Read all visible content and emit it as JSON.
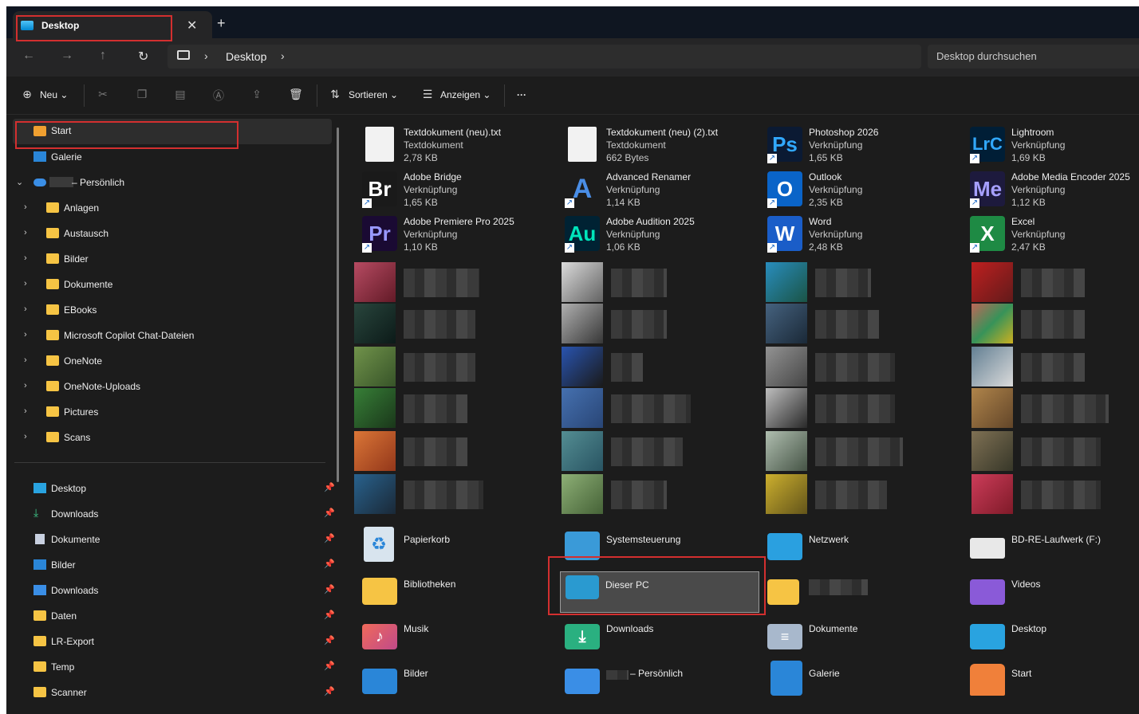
{
  "tab": {
    "title": "Desktop",
    "close": "✕",
    "new": "+"
  },
  "nav": {
    "back": "←",
    "forward": "→",
    "up": "↑",
    "refresh": "↻"
  },
  "address": {
    "segment": "Desktop",
    "sep": "›"
  },
  "search": {
    "placeholder": "Desktop durchsuchen"
  },
  "toolbar": {
    "new": "Neu",
    "sort": "Sortieren",
    "view": "Anzeigen",
    "more": "···"
  },
  "sidebar": {
    "start": "Start",
    "gallery": "Galerie",
    "onedrive": "– Persönlich",
    "folders": [
      "Anlagen",
      "Austausch",
      "Bilder",
      "Dokumente",
      "EBooks",
      "Microsoft Copilot Chat-Dateien",
      "OneNote",
      "OneNote-Uploads",
      "Pictures",
      "Scans"
    ],
    "pinned": [
      "Desktop",
      "Downloads",
      "Dokumente",
      "Bilder",
      "Downloads",
      "Daten",
      "LR-Export",
      "Temp",
      "Scanner"
    ]
  },
  "files": [
    {
      "name": "Textdokument (neu).txt",
      "type": "Textdokument",
      "size": "2,78 KB",
      "icon": "text-file-icon"
    },
    {
      "name": "Textdokument (neu) (2).txt",
      "type": "Textdokument",
      "size": "662 Bytes",
      "icon": "text-file-icon"
    },
    {
      "name": "Photoshop 2026",
      "type": "Verknüpfung",
      "size": "1,65 KB",
      "icon": "Ps"
    },
    {
      "name": "Lightroom",
      "type": "Verknüpfung",
      "size": "1,69 KB",
      "icon": "LrC"
    },
    {
      "name": "Adobe Bridge",
      "type": "Verknüpfung",
      "size": "1,65 KB",
      "icon": "Br"
    },
    {
      "name": "Advanced Renamer",
      "type": "Verknüpfung",
      "size": "1,14 KB",
      "icon": "A"
    },
    {
      "name": "Outlook",
      "type": "Verknüpfung",
      "size": "2,35 KB",
      "icon": "O"
    },
    {
      "name": "Adobe Media Encoder 2025",
      "type": "Verknüpfung",
      "size": "1,12 KB",
      "icon": "Me"
    },
    {
      "name": "Adobe Premiere Pro 2025",
      "type": "Verknüpfung",
      "size": "1,10 KB",
      "icon": "Pr"
    },
    {
      "name": "Adobe Audition 2025",
      "type": "Verknüpfung",
      "size": "1,06 KB",
      "icon": "Au"
    },
    {
      "name": "Word",
      "type": "Verknüpfung",
      "size": "2,48 KB",
      "icon": "W"
    },
    {
      "name": "Excel",
      "type": "Verknüpfung",
      "size": "2,47 KB",
      "icon": "X"
    }
  ],
  "system": [
    {
      "name": "Papierkorb"
    },
    {
      "name": "Systemsteuerung"
    },
    {
      "name": "Netzwerk"
    },
    {
      "name": "BD-RE-Laufwerk (F:)"
    },
    {
      "name": "Bibliotheken"
    },
    {
      "name": "Dieser PC"
    },
    {
      "name": ""
    },
    {
      "name": "Videos"
    },
    {
      "name": "Musik"
    },
    {
      "name": "Downloads"
    },
    {
      "name": "Dokumente"
    },
    {
      "name": "Desktop"
    },
    {
      "name": "Bilder"
    },
    {
      "name": "– Persönlich"
    },
    {
      "name": "Galerie"
    },
    {
      "name": "Start"
    }
  ],
  "colors": {
    "highlight": "#d32f2f",
    "ps": "#0b1a33",
    "lrc": "#001e36",
    "br": "#1a1a1a",
    "me": "#1d1a3d",
    "pr": "#1a0a33",
    "au": "#002233"
  }
}
